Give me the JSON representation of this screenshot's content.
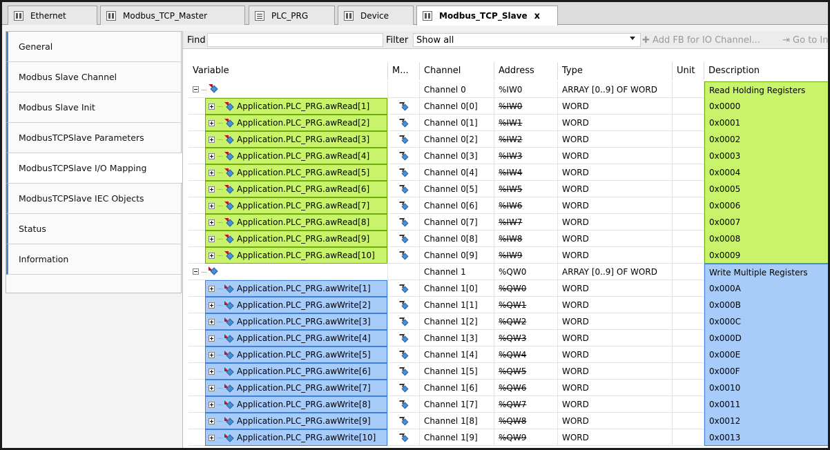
{
  "tabs": [
    {
      "label": "Ethernet",
      "icon": "device-icon"
    },
    {
      "label": "Modbus_TCP_Master",
      "icon": "device-icon"
    },
    {
      "label": "PLC_PRG",
      "icon": "program-icon"
    },
    {
      "label": "Device",
      "icon": "device-icon"
    },
    {
      "label": "Modbus_TCP_Slave",
      "icon": "device-icon",
      "active": true,
      "close": "x"
    }
  ],
  "nav": [
    "General",
    "Modbus Slave Channel",
    "Modbus Slave Init",
    "ModbusTCPSlave Parameters",
    "ModbusTCPSlave I/O Mapping",
    "ModbusTCPSlave IEC Objects",
    "Status",
    "Information"
  ],
  "toolbar": {
    "find_label": "Find",
    "filter_label": "Filter",
    "filter_value": "Show all",
    "add_fb": "Add FB for IO Channel...",
    "goto": "Go to In"
  },
  "columns": [
    "Variable",
    "M...",
    "Channel",
    "Address",
    "Type",
    "Unit",
    "Description"
  ],
  "colors": {
    "read_highlight": "#c8f36a",
    "write_highlight": "#a8ccfa"
  },
  "groups": [
    {
      "channel": "Channel 0",
      "address": "%IW0",
      "type": "ARRAY [0..9] OF WORD",
      "description": "Read Holding Registers",
      "rows": [
        {
          "variable": "Application.PLC_PRG.awRead[1]",
          "channel": "Channel 0[0]",
          "address": "%IW0",
          "type": "WORD",
          "description": "0x0000"
        },
        {
          "variable": "Application.PLC_PRG.awRead[2]",
          "channel": "Channel 0[1]",
          "address": "%IW1",
          "type": "WORD",
          "description": "0x0001"
        },
        {
          "variable": "Application.PLC_PRG.awRead[3]",
          "channel": "Channel 0[2]",
          "address": "%IW2",
          "type": "WORD",
          "description": "0x0002"
        },
        {
          "variable": "Application.PLC_PRG.awRead[4]",
          "channel": "Channel 0[3]",
          "address": "%IW3",
          "type": "WORD",
          "description": "0x0003"
        },
        {
          "variable": "Application.PLC_PRG.awRead[5]",
          "channel": "Channel 0[4]",
          "address": "%IW4",
          "type": "WORD",
          "description": "0x0004"
        },
        {
          "variable": "Application.PLC_PRG.awRead[6]",
          "channel": "Channel 0[5]",
          "address": "%IW5",
          "type": "WORD",
          "description": "0x0005"
        },
        {
          "variable": "Application.PLC_PRG.awRead[7]",
          "channel": "Channel 0[6]",
          "address": "%IW6",
          "type": "WORD",
          "description": "0x0006"
        },
        {
          "variable": "Application.PLC_PRG.awRead[8]",
          "channel": "Channel 0[7]",
          "address": "%IW7",
          "type": "WORD",
          "description": "0x0007"
        },
        {
          "variable": "Application.PLC_PRG.awRead[9]",
          "channel": "Channel 0[8]",
          "address": "%IW8",
          "type": "WORD",
          "description": "0x0008"
        },
        {
          "variable": "Application.PLC_PRG.awRead[10]",
          "channel": "Channel 0[9]",
          "address": "%IW9",
          "type": "WORD",
          "description": "0x0009"
        }
      ]
    },
    {
      "channel": "Channel 1",
      "address": "%QW0",
      "type": "ARRAY [0..9] OF WORD",
      "description": "Write Multiple Registers",
      "rows": [
        {
          "variable": "Application.PLC_PRG.awWrite[1]",
          "channel": "Channel 1[0]",
          "address": "%QW0",
          "type": "WORD",
          "description": "0x000A"
        },
        {
          "variable": "Application.PLC_PRG.awWrite[2]",
          "channel": "Channel 1[1]",
          "address": "%QW1",
          "type": "WORD",
          "description": "0x000B"
        },
        {
          "variable": "Application.PLC_PRG.awWrite[3]",
          "channel": "Channel 1[2]",
          "address": "%QW2",
          "type": "WORD",
          "description": "0x000C"
        },
        {
          "variable": "Application.PLC_PRG.awWrite[4]",
          "channel": "Channel 1[3]",
          "address": "%QW3",
          "type": "WORD",
          "description": "0x000D"
        },
        {
          "variable": "Application.PLC_PRG.awWrite[5]",
          "channel": "Channel 1[4]",
          "address": "%QW4",
          "type": "WORD",
          "description": "0x000E"
        },
        {
          "variable": "Application.PLC_PRG.awWrite[6]",
          "channel": "Channel 1[5]",
          "address": "%QW5",
          "type": "WORD",
          "description": "0x000F"
        },
        {
          "variable": "Application.PLC_PRG.awWrite[7]",
          "channel": "Channel 1[6]",
          "address": "%QW6",
          "type": "WORD",
          "description": "0x0010"
        },
        {
          "variable": "Application.PLC_PRG.awWrite[8]",
          "channel": "Channel 1[7]",
          "address": "%QW7",
          "type": "WORD",
          "description": "0x0011"
        },
        {
          "variable": "Application.PLC_PRG.awWrite[9]",
          "channel": "Channel 1[8]",
          "address": "%QW8",
          "type": "WORD",
          "description": "0x0012"
        },
        {
          "variable": "Application.PLC_PRG.awWrite[10]",
          "channel": "Channel 1[9]",
          "address": "%QW9",
          "type": "WORD",
          "description": "0x0013"
        }
      ]
    }
  ]
}
